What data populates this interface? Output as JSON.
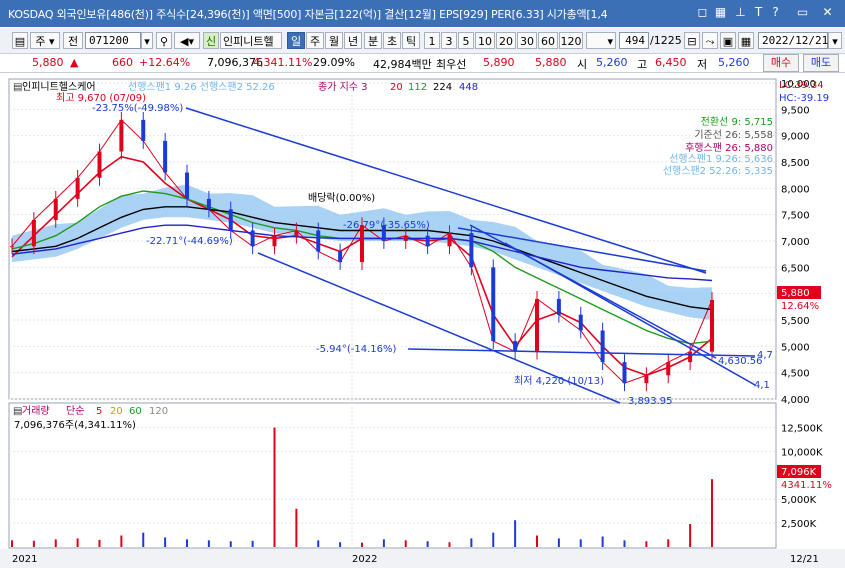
{
  "title_bar": {
    "text": "KOSDAQ 외국인보유[486(천)] 주식수[24,396(천)] 액면[500] 자본금[122(억)] 결산[12월] EPS[929] PER[6.33] 시가총액[1,4",
    "icons": [
      "window-icon",
      "grid-icon",
      "pin-icon",
      "text-icon",
      "help-icon",
      "restore-icon",
      "close-icon"
    ]
  },
  "toolbar": {
    "stock_type": "주",
    "prev_label": "전",
    "code": "071200",
    "name_prefix": "신",
    "name": "인피니트헬",
    "periods": [
      "일",
      "주",
      "월",
      "년",
      "분",
      "초",
      "틱"
    ],
    "counts": [
      "1",
      "3",
      "5",
      "10",
      "20",
      "30",
      "60",
      "120"
    ],
    "position": "494",
    "total": "/1225",
    "date": "2022/12/21"
  },
  "quote": {
    "price": "5,880",
    "change": "660",
    "change_pct": "+12.64%",
    "volume": "7,096,376",
    "volume_pct": "4,341.11%",
    "turnover": "29.09%",
    "amount": "42,984백만",
    "best_bid_label": "최우선",
    "best_bid": "5,890",
    "best_ask": "5,880",
    "open_label": "시",
    "open": "5,260",
    "high_label": "고",
    "high": "6,450",
    "low_label": "저",
    "low": "5,260",
    "buy_label": "매수",
    "sell_label": "매도"
  },
  "price_panel": {
    "legend_name": "인피니트헬스케어",
    "legend_ichimoku": "선행스팬1 9.26  선행스팬2 52.26",
    "legend_ma": "종가 지수 3",
    "ma_periods": [
      "20",
      "112",
      "224",
      "448"
    ],
    "corner_lc": "LC:39.34",
    "corner_hc": "HC:-39.19",
    "hi_annot": "최고 9,670 (07/09)",
    "hi_pct": "-23.75%(-49.98%)",
    "dividend": "배당락(0.00%)",
    "trend1": "-22.71°(-44.69%)",
    "trend2": "-26.79°(-35.65%)",
    "trend3": "-5.94°(-14.16%)",
    "low_annot": "최저 4,220 (10/13)",
    "low_val": "3,893.95",
    "ch1": "4,630.56",
    "ch2": "4,7",
    "ch3": "4,1",
    "ichi_conv": "전환선 9: 5,715",
    "ichi_base": "기준선 26: 5,558",
    "ichi_lag": "후행스팬 26: 5,880",
    "ichi_lead1": "선행스팬1 9.26: 5,636",
    "ichi_lead2": "선행스팬2 52.26: 5,335",
    "price_tag": "5,880",
    "price_tag_pct": "12.64%",
    "y_labels": [
      "10,000",
      "9,500",
      "9,000",
      "8,500",
      "8,000",
      "7,500",
      "7,000",
      "6,500",
      "6,000",
      "5,500",
      "5,000",
      "4,500",
      "4,000"
    ]
  },
  "volume_panel": {
    "legend": "거래량",
    "legend_sub": "단순",
    "periods": [
      "5",
      "20",
      "60",
      "120"
    ],
    "value_label": "7,096,376주(4,341.11%)",
    "tag": "7,096K",
    "tag_pct": "4341.11%",
    "y_labels": [
      "12,500K",
      "10,000K",
      "5,000K",
      "2,500K"
    ]
  },
  "x_axis": {
    "labels": [
      "2021",
      "2022",
      "12/21"
    ]
  },
  "colors": {
    "accent": "#3b6fb6",
    "up": "#e0001c",
    "down": "#1a3bd6",
    "ichimoku_cloud": "#8cc3f2",
    "ma20": "#e0001c",
    "ma112": "#1e9b1e",
    "ma224": "#000000",
    "ma448": "#2222cc"
  },
  "chart_data": {
    "type": "line",
    "series": [
      {
        "name": "종가",
        "values": [
          6900,
          7400,
          7800,
          8200,
          8700,
          9300,
          8900,
          8300,
          7800,
          7600,
          7200,
          6900,
          7100,
          7200,
          6800,
          6600,
          7300,
          7000,
          7100,
          6900,
          7150,
          6500,
          5100,
          4900,
          5900,
          5600,
          5300,
          4700,
          4300,
          4450,
          4700,
          4900,
          5880
        ]
      },
      {
        "name": "20",
        "values": [
          6700,
          7100,
          7500,
          7900,
          8300,
          8600,
          8500,
          8100,
          7800,
          7600,
          7400,
          7100,
          7050,
          7100,
          6950,
          6800,
          7050,
          7050,
          7050,
          7000,
          7050,
          6700,
          5600,
          5000,
          5500,
          5650,
          5450,
          5000,
          4600,
          4450,
          4600,
          4800,
          5150
        ]
      },
      {
        "name": "112",
        "values": [
          6850,
          6950,
          7100,
          7350,
          7650,
          7850,
          7950,
          7900,
          7800,
          7650,
          7500,
          7350,
          7250,
          7200,
          7100,
          7050,
          7050,
          7050,
          7050,
          7050,
          7050,
          7000,
          6800,
          6500,
          6300,
          6100,
          5900,
          5700,
          5500,
          5300,
          5150,
          5050,
          5100
        ]
      },
      {
        "name": "224",
        "values": [
          6800,
          6850,
          6900,
          7050,
          7250,
          7450,
          7600,
          7650,
          7650,
          7600,
          7550,
          7450,
          7350,
          7300,
          7250,
          7200,
          7200,
          7200,
          7200,
          7200,
          7150,
          7100,
          7000,
          6850,
          6700,
          6550,
          6400,
          6250,
          6100,
          5950,
          5850,
          5750,
          5700
        ]
      },
      {
        "name": "448",
        "values": [
          6750,
          6800,
          6850,
          6950,
          7050,
          7150,
          7250,
          7300,
          7300,
          7250,
          7200,
          7150,
          7100,
          7080,
          7060,
          7050,
          7050,
          7050,
          7050,
          7050,
          7050,
          7000,
          6900,
          6800,
          6700,
          6600,
          6500,
          6450,
          6400,
          6350,
          6300,
          6280,
          6250
        ]
      }
    ],
    "volume": [
      700,
      650,
      800,
      900,
      750,
      1200,
      1500,
      1000,
      800,
      700,
      600,
      650,
      12500,
      4000,
      700,
      500,
      450,
      800,
      700,
      600,
      500,
      900,
      1500,
      2800,
      1200,
      900,
      800,
      1100,
      700,
      600,
      800,
      2400,
      7096
    ],
    "ylim": [
      4000,
      10000
    ],
    "volume_ylim": [
      0,
      13500
    ],
    "grid": true,
    "legend_placement": "top-left"
  }
}
